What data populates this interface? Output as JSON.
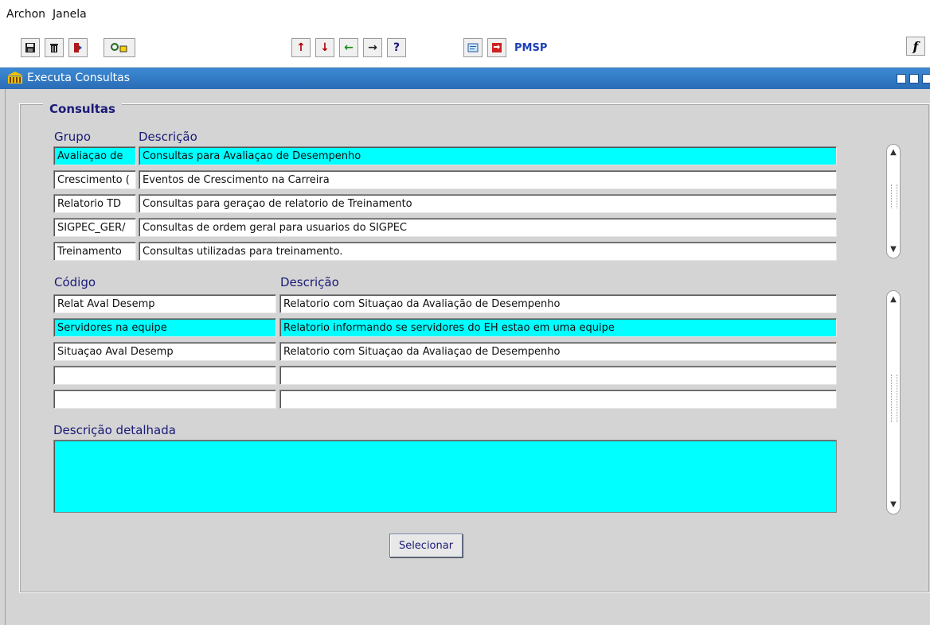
{
  "menu": {
    "items": [
      "Archon",
      "Janela"
    ]
  },
  "toolbar": {
    "brand_label": "PMSP"
  },
  "window": {
    "title": "Executa Consultas"
  },
  "section": {
    "legend": "Consultas"
  },
  "grupos": {
    "col_grupo": "Grupo",
    "col_descricao": "Descrição",
    "rows": [
      {
        "grupo": "Avaliaçao de",
        "descricao": "Consultas para Avaliaçao de Desempenho",
        "selected": true
      },
      {
        "grupo": "Crescimento (",
        "descricao": "Eventos de Crescimento na Carreira",
        "selected": false
      },
      {
        "grupo": "Relatorio TD",
        "descricao": "Consultas para geraçao de relatorio de Treinamento",
        "selected": false
      },
      {
        "grupo": "SIGPEC_GER/",
        "descricao": "Consultas de ordem geral para usuarios do SIGPEC",
        "selected": false
      },
      {
        "grupo": "Treinamento",
        "descricao": "Consultas utilizadas para treinamento.",
        "selected": false
      }
    ]
  },
  "consultas": {
    "col_codigo": "Código",
    "col_descricao": "Descrição",
    "rows": [
      {
        "codigo": "Relat Aval Desemp",
        "descricao": "Relatorio com Situaçao da Avaliação de Desempenho",
        "selected": false
      },
      {
        "codigo": "Servidores na equipe",
        "descricao": "Relatorio informando se servidores do EH estao em uma equipe",
        "selected": true
      },
      {
        "codigo": "Situaçao Aval Desemp",
        "descricao": "Relatorio com Situaçao da Avaliaçao de Desempenho",
        "selected": false
      },
      {
        "codigo": "",
        "descricao": "",
        "selected": false
      },
      {
        "codigo": "",
        "descricao": "",
        "selected": false
      }
    ]
  },
  "detalhe": {
    "label": "Descrição detalhada",
    "value": ""
  },
  "actions": {
    "select_label": "Selecionar"
  },
  "colors": {
    "selected": "#00ffff",
    "title_blue": "#2a6cb6",
    "label_navy": "#1a1a78"
  }
}
